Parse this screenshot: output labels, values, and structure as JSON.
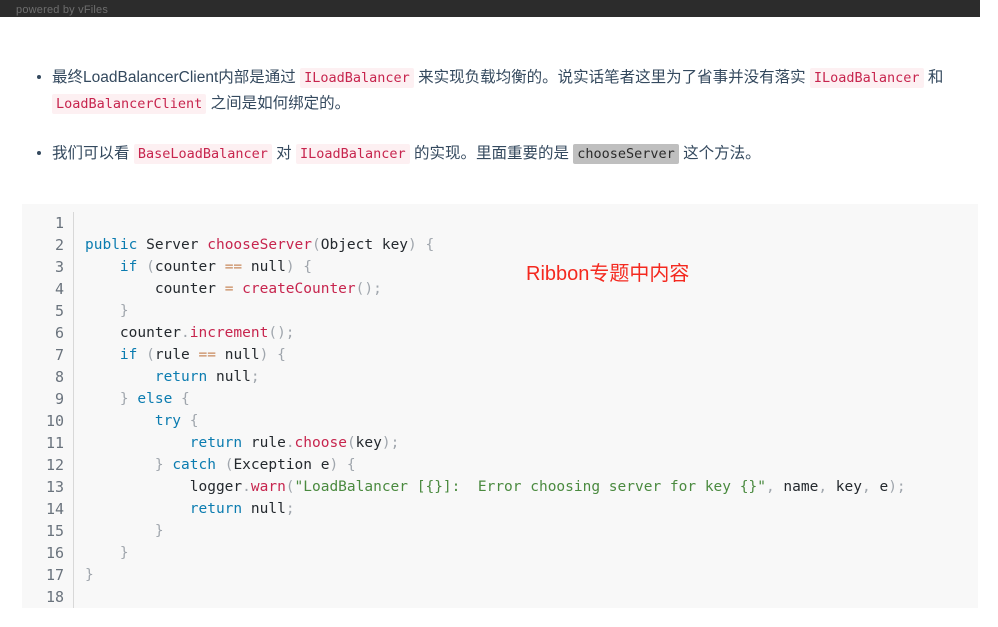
{
  "topbar": {
    "label": "powered by vFiles",
    "background": "#2c2c2c",
    "text_color": "#6e6e6e"
  },
  "bullets": [
    {
      "id": "bullet-1",
      "segments": [
        {
          "type": "text",
          "value": "最终LoadBalancerClient内部是通过 "
        },
        {
          "type": "code",
          "value": "ILoadBalancer"
        },
        {
          "type": "text",
          "value": " 来实现负载均衡的。说实话笔者这里为了省事并没有落实 "
        },
        {
          "type": "code",
          "value": "ILoadBalancer"
        },
        {
          "type": "text",
          "value": " 和 "
        },
        {
          "type": "code",
          "value": "LoadBalancerClient"
        },
        {
          "type": "text",
          "value": " 之间是如何绑定的。"
        }
      ]
    },
    {
      "id": "bullet-2",
      "segments": [
        {
          "type": "text",
          "value": "我们可以看 "
        },
        {
          "type": "code",
          "value": "BaseLoadBalancer"
        },
        {
          "type": "text",
          "value": " 对 "
        },
        {
          "type": "code",
          "value": "ILoadBalancer"
        },
        {
          "type": "text",
          "value": " 的实现。里面重要的是 "
        },
        {
          "type": "code-selected",
          "value": "chooseServer"
        },
        {
          "type": "text",
          "value": " 这个方法。"
        }
      ]
    }
  ],
  "code_block": {
    "language": "java",
    "background": "#f8f8f8",
    "line_numbers": [
      "1",
      "2",
      "3",
      "4",
      "5",
      "6",
      "7",
      "8",
      "9",
      "10",
      "11",
      "12",
      "13",
      "14",
      "15",
      "16",
      "17",
      "18"
    ],
    "lines": [
      [],
      [
        {
          "t": "kw",
          "v": "public"
        },
        {
          "t": "plain",
          "v": " Server "
        },
        {
          "t": "fn",
          "v": "chooseServer"
        },
        {
          "t": "punc",
          "v": "("
        },
        {
          "t": "plain",
          "v": "Object key"
        },
        {
          "t": "punc",
          "v": ") {"
        }
      ],
      [
        {
          "t": "plain",
          "v": "    "
        },
        {
          "t": "kw",
          "v": "if"
        },
        {
          "t": "punc",
          "v": " ("
        },
        {
          "t": "plain",
          "v": "counter "
        },
        {
          "t": "op",
          "v": "=="
        },
        {
          "t": "plain",
          "v": " null"
        },
        {
          "t": "punc",
          "v": ") {"
        }
      ],
      [
        {
          "t": "plain",
          "v": "        counter "
        },
        {
          "t": "op",
          "v": "="
        },
        {
          "t": "plain",
          "v": " "
        },
        {
          "t": "fn",
          "v": "createCounter"
        },
        {
          "t": "punc",
          "v": "();"
        }
      ],
      [
        {
          "t": "punc",
          "v": "    }"
        }
      ],
      [
        {
          "t": "plain",
          "v": "    counter"
        },
        {
          "t": "punc",
          "v": "."
        },
        {
          "t": "fn",
          "v": "increment"
        },
        {
          "t": "punc",
          "v": "();"
        }
      ],
      [
        {
          "t": "plain",
          "v": "    "
        },
        {
          "t": "kw",
          "v": "if"
        },
        {
          "t": "punc",
          "v": " ("
        },
        {
          "t": "plain",
          "v": "rule "
        },
        {
          "t": "op",
          "v": "=="
        },
        {
          "t": "plain",
          "v": " null"
        },
        {
          "t": "punc",
          "v": ") {"
        }
      ],
      [
        {
          "t": "plain",
          "v": "        "
        },
        {
          "t": "kw",
          "v": "return"
        },
        {
          "t": "plain",
          "v": " null"
        },
        {
          "t": "punc",
          "v": ";"
        }
      ],
      [
        {
          "t": "punc",
          "v": "    } "
        },
        {
          "t": "kw",
          "v": "else"
        },
        {
          "t": "punc",
          "v": " {"
        }
      ],
      [
        {
          "t": "plain",
          "v": "        "
        },
        {
          "t": "kw",
          "v": "try"
        },
        {
          "t": "punc",
          "v": " {"
        }
      ],
      [
        {
          "t": "plain",
          "v": "            "
        },
        {
          "t": "kw",
          "v": "return"
        },
        {
          "t": "plain",
          "v": " rule"
        },
        {
          "t": "punc",
          "v": "."
        },
        {
          "t": "fn",
          "v": "choose"
        },
        {
          "t": "punc",
          "v": "("
        },
        {
          "t": "plain",
          "v": "key"
        },
        {
          "t": "punc",
          "v": ");"
        }
      ],
      [
        {
          "t": "punc",
          "v": "        } "
        },
        {
          "t": "kw",
          "v": "catch"
        },
        {
          "t": "punc",
          "v": " ("
        },
        {
          "t": "plain",
          "v": "Exception e"
        },
        {
          "t": "punc",
          "v": ") {"
        }
      ],
      [
        {
          "t": "plain",
          "v": "            logger"
        },
        {
          "t": "punc",
          "v": "."
        },
        {
          "t": "fn",
          "v": "warn"
        },
        {
          "t": "punc",
          "v": "("
        },
        {
          "t": "str",
          "v": "\"LoadBalancer [{}]:  Error choosing server for key {}\""
        },
        {
          "t": "punc",
          "v": ", "
        },
        {
          "t": "plain",
          "v": "name"
        },
        {
          "t": "punc",
          "v": ", "
        },
        {
          "t": "plain",
          "v": "key"
        },
        {
          "t": "punc",
          "v": ", "
        },
        {
          "t": "plain",
          "v": "e"
        },
        {
          "t": "punc",
          "v": ");"
        }
      ],
      [
        {
          "t": "plain",
          "v": "            "
        },
        {
          "t": "kw",
          "v": "return"
        },
        {
          "t": "plain",
          "v": " null"
        },
        {
          "t": "punc",
          "v": ";"
        }
      ],
      [
        {
          "t": "punc",
          "v": "        }"
        }
      ],
      [
        {
          "t": "punc",
          "v": "    }"
        }
      ],
      [
        {
          "t": "punc",
          "v": "}"
        }
      ],
      []
    ],
    "annotation": {
      "text": "Ribbon专题中内容",
      "color": "#f4291f"
    }
  }
}
